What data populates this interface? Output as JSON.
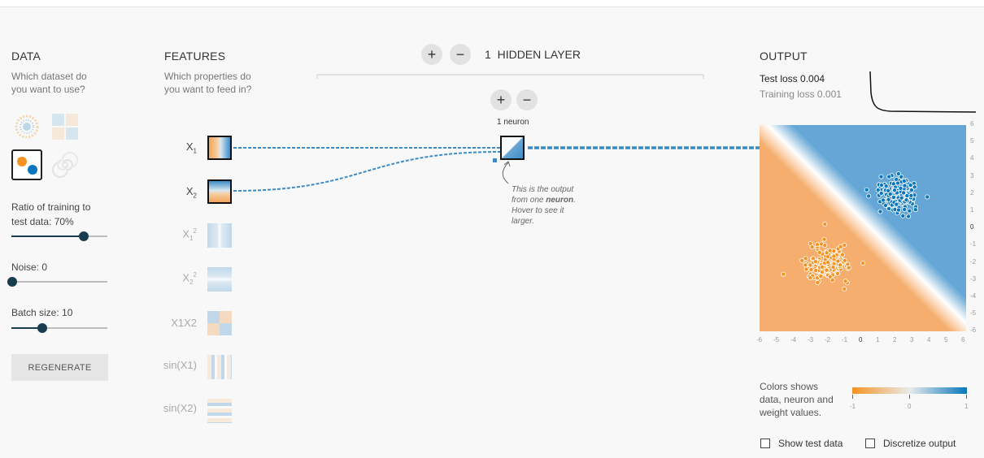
{
  "data": {
    "title": "DATA",
    "subtitle_line1": "Which dataset do",
    "subtitle_line2": "you want to use?",
    "datasets": [
      "circle",
      "xor",
      "gaussian",
      "spiral"
    ],
    "selected_dataset": "gaussian",
    "ratio_label_line1": "Ratio of training to",
    "ratio_label_line2": "test data:  70%",
    "ratio_value": 0.7,
    "noise_label": "Noise:  0",
    "noise_value": 0,
    "batch_label": "Batch size:  10",
    "batch_value": 10,
    "regenerate_label": "REGENERATE"
  },
  "features": {
    "title": "FEATURES",
    "subtitle_line1": "Which properties do",
    "subtitle_line2": "you want to feed in?",
    "items": [
      {
        "label": "X",
        "sub": "1",
        "sup": "",
        "active": true
      },
      {
        "label": "X",
        "sub": "2",
        "sup": "",
        "active": true
      },
      {
        "label": "X",
        "sub": "1",
        "sup": "2",
        "active": false
      },
      {
        "label": "X",
        "sub": "2",
        "sup": "2",
        "active": false
      },
      {
        "label": "X1X2",
        "sub": "",
        "sup": "",
        "active": false
      },
      {
        "label": "sin(X1)",
        "sub": "",
        "sup": "",
        "active": false
      },
      {
        "label": "sin(X2)",
        "sub": "",
        "sup": "",
        "active": false
      }
    ]
  },
  "network": {
    "layer_count": "1",
    "layer_label": "HIDDEN LAYER",
    "neuron_count_label": "1 neuron",
    "note_line1": "This is the output",
    "note_line2_pre": "from one ",
    "note_line2_bold": "neuron",
    "note_line2_post": ".",
    "note_line3": "Hover to see it",
    "note_line4": "larger."
  },
  "output": {
    "title": "OUTPUT",
    "test_loss": "Test loss 0.004",
    "training_loss": "Training loss 0.001",
    "x_ticks": [
      "-6",
      "-5",
      "-4",
      "-3",
      "-2",
      "-1",
      "0",
      "1",
      "2",
      "3",
      "4",
      "5",
      "6"
    ],
    "y_ticks": [
      "6",
      "5",
      "4",
      "3",
      "2",
      "1",
      "0",
      "-1",
      "-2",
      "-3",
      "-4",
      "-5",
      "-6"
    ],
    "legend_line1": "Colors shows",
    "legend_line2": "data, neuron and",
    "legend_line3": "weight values.",
    "legend_ticks": [
      "-1",
      "0",
      "1"
    ],
    "show_test_label": "Show test data",
    "discretize_label": "Discretize output",
    "colors": {
      "orange": "#f59322",
      "blue": "#0877bd",
      "dark": "#183d4e"
    }
  }
}
